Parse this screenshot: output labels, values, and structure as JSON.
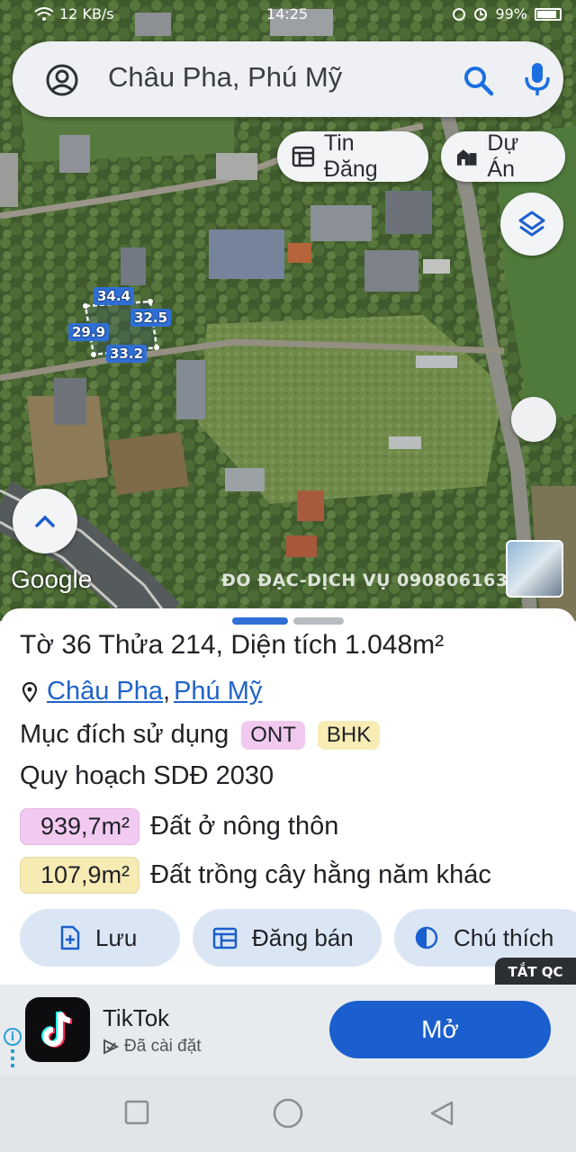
{
  "status_bar": {
    "speed": "12 KB/s",
    "time": "14:25",
    "battery": "99%"
  },
  "search": {
    "query": "Châu Pha, Phú Mỹ"
  },
  "chips": {
    "news": "Tin Đăng",
    "projects": "Dự Án"
  },
  "map": {
    "google": "Google",
    "watermark": "ĐO ĐẠC-DỊCH VỤ 0908061636",
    "parcel_edges": [
      "34.4",
      "32.5",
      "29.9",
      "33.2"
    ]
  },
  "parcel": {
    "title": "Tờ 36 Thửa 214, Diện tích 1.048m²",
    "ward": "Châu Pha",
    "separator": ",",
    "town": "Phú Mỹ",
    "usage_label": "Mục đích sử dụng",
    "usage_tags": [
      "ONT",
      "BHK"
    ],
    "plan_title": "Quy hoạch SDĐ 2030",
    "areas": [
      {
        "value": "939,7m²",
        "label": "Đất ở nông thôn",
        "color": "#f2c9f0"
      },
      {
        "value": "107,9m²",
        "label": "Đất trồng cây hằng năm khác",
        "color": "#f6ebb3"
      }
    ]
  },
  "actions": {
    "save": "Lưu",
    "sell": "Đăng bán",
    "legend": "Chú thích"
  },
  "ad": {
    "close": "TẮT QC",
    "app_name": "TikTok",
    "installed": "Đã cài đặt",
    "open": "Mở"
  },
  "colors": {
    "accent": "#1b5fce",
    "link": "#1f63c8",
    "button_bg": "#dbe6f5"
  }
}
